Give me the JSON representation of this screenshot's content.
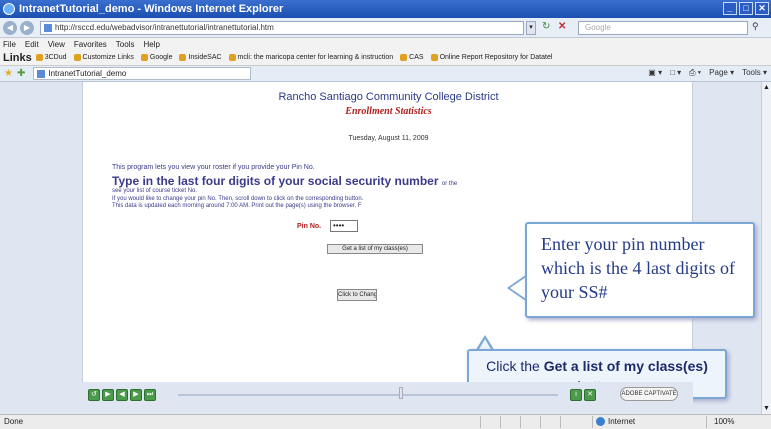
{
  "window": {
    "title": "IntranetTutorial_demo - Windows Internet Explorer",
    "buttons": [
      "_",
      "□",
      "✕"
    ]
  },
  "address_bar": {
    "url": "http://rsccd.edu/webadvisor/intranettutorial/intranettutorial.htm",
    "search_placeholder": "Google"
  },
  "menu": {
    "items": [
      "File",
      "Edit",
      "View",
      "Favorites",
      "Tools",
      "Help"
    ]
  },
  "links_bar": {
    "label": "Links",
    "items": [
      "3CDud",
      "Customize Links",
      "Google",
      "InsideSAC",
      "mcli: the maricopa center for learning & instruction",
      "CAS",
      "Online Report Repository for Datatel"
    ]
  },
  "tab": {
    "label": "IntranetTutorial_demo"
  },
  "command_bar": {
    "items": [
      "▣ ▾",
      "□ ▾",
      "⎙ ▾",
      "Page ▾",
      "Tools ▾"
    ]
  },
  "page": {
    "title": "Rancho Santiago Community College District",
    "subtitle": "Enrollment Statistics",
    "date": "Tuesday, August 11, 2009",
    "intro": "This program lets you view your roster if you provide your Pin No.",
    "instruction": "Type in the last four digits of your social security number",
    "instruction_tail": "or the",
    "line1": "see your list of course ticket No.",
    "line2": "If you would like to change your pin No. Then, scroll down to click on the corresponding button.",
    "line3": "This data is updated each morning around 7:00 AM. Print out the page(s) using the browser. F",
    "pin_label": "Pin No.",
    "pin_value": "••••",
    "list_button": "Get a list of my class(es)",
    "other_button": "Click to Change PIN"
  },
  "callouts": {
    "pin": "Enter your pin number which is the 4 last digits of your SS#",
    "button_pre": "Click the ",
    "button_bold": "Get a list of my class(es)",
    "button_post": " button"
  },
  "player": {
    "adobe_label": "ADOBE CAPTIVATE"
  },
  "status": {
    "text": "Done",
    "zone": "Internet",
    "zoom": "100%"
  }
}
